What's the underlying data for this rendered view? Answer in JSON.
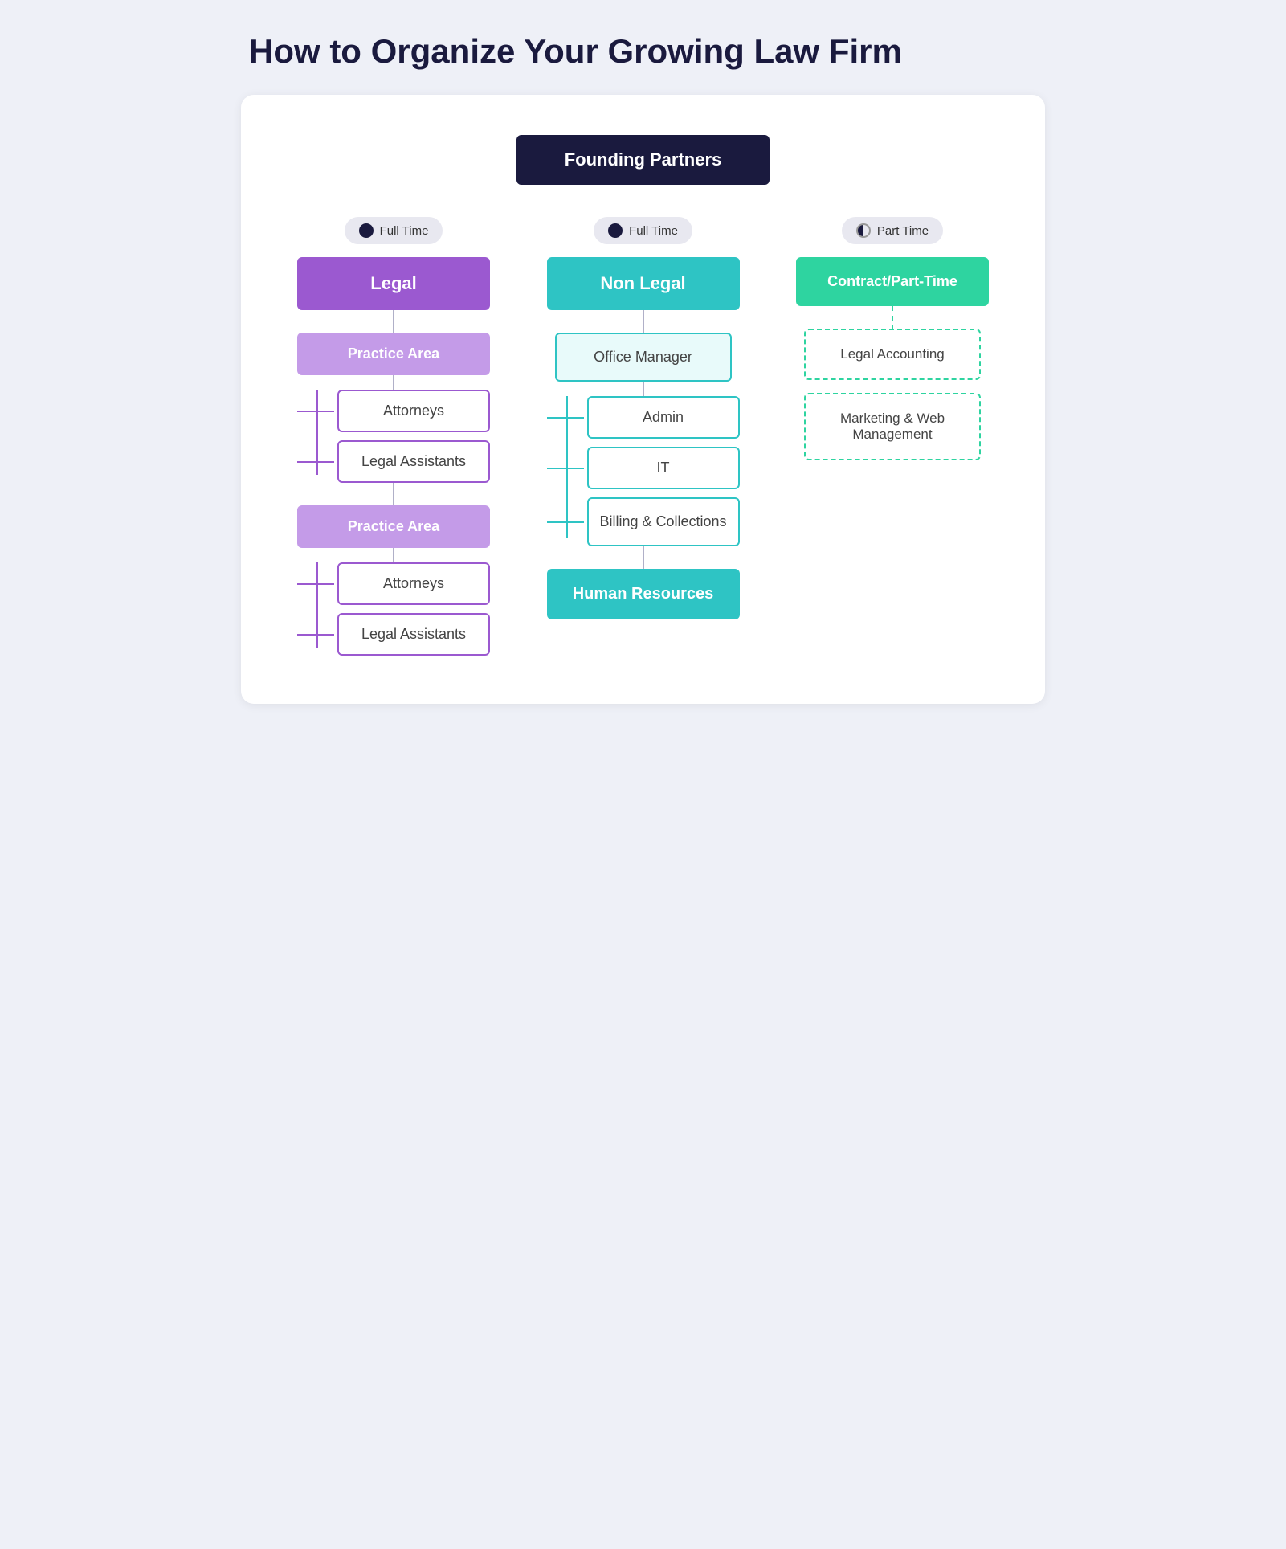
{
  "title": "How to Organize Your Growing Law Firm",
  "chart": {
    "founding_partners": "Founding Partners",
    "columns": [
      {
        "id": "legal",
        "badge": "Full Time",
        "badge_type": "full",
        "category": "Legal",
        "category_color": "purple",
        "sections": [
          {
            "label": "Practice Area",
            "children": [
              "Attorneys",
              "Legal Assistants"
            ]
          },
          {
            "label": "Practice Area",
            "children": [
              "Attorneys",
              "Legal Assistants"
            ]
          }
        ]
      },
      {
        "id": "nonlegal",
        "badge": "Full Time",
        "badge_type": "full",
        "category": "Non Legal",
        "category_color": "cyan",
        "sections": [
          {
            "label": "Office Manager",
            "children": [
              "Admin",
              "IT",
              "Billing & Collections"
            ]
          },
          {
            "label": "Human Resources",
            "children": []
          }
        ]
      },
      {
        "id": "contract",
        "badge": "Part Time",
        "badge_type": "half",
        "category": "Contract/Part-Time",
        "category_color": "green",
        "items": [
          "Legal Accounting",
          "Marketing & Web Management"
        ]
      }
    ]
  }
}
